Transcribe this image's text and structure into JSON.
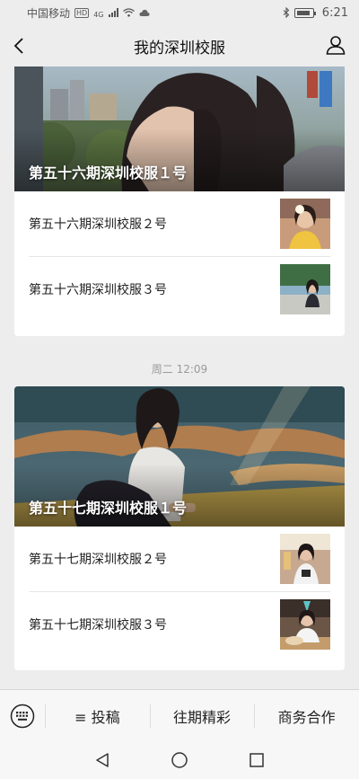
{
  "status_bar": {
    "carrier": "中国移动",
    "hd_badge": "HD",
    "network": "4G",
    "time": "6:21"
  },
  "nav": {
    "title": "我的深圳校服"
  },
  "issue_1": {
    "cover_title": "第五十六期深圳校服１号",
    "articles": [
      {
        "title": "第五十六期深圳校服２号"
      },
      {
        "title": "第五十六期深圳校服３号"
      }
    ]
  },
  "timestamp": "周二 12:09",
  "issue_2": {
    "cover_title": "第五十七期深圳校服１号",
    "articles": [
      {
        "title": "第五十七期深圳校服２号"
      },
      {
        "title": "第五十七期深圳校服３号"
      }
    ]
  },
  "bottom_menu": {
    "items": [
      {
        "label": "≡ 投稿"
      },
      {
        "label": "往期精彩"
      },
      {
        "label": "商务合作"
      }
    ]
  },
  "icons": {
    "back": "chevron-left-icon",
    "profile": "person-icon",
    "keyboard": "keyboard-icon"
  }
}
